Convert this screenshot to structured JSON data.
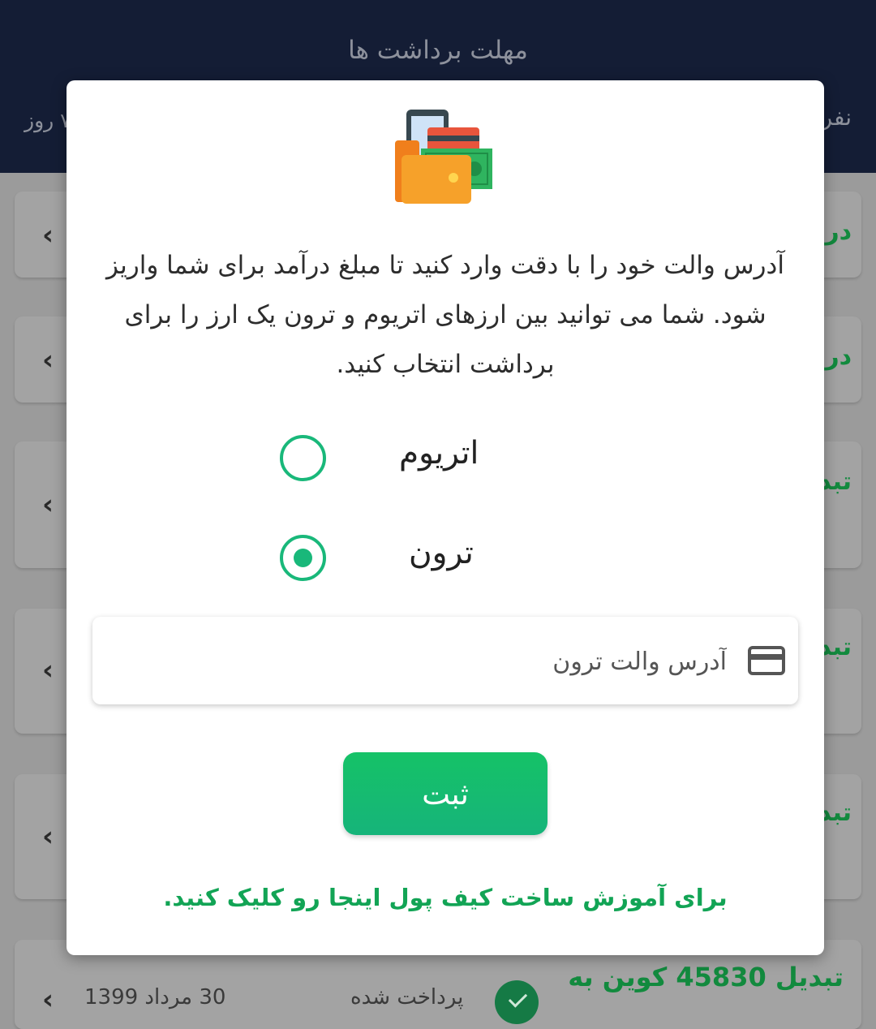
{
  "header": {
    "title": "مهلت برداشت ها",
    "left_text": "۷ روز",
    "right_text": "نفر"
  },
  "background_cards": [
    {
      "text": "در"
    },
    {
      "text": "در"
    },
    {
      "text": "تبد"
    },
    {
      "text": "تبد"
    },
    {
      "text": "تبد"
    }
  ],
  "last_card": {
    "title": "تبدیل 45830 کوین به",
    "status": "پرداخت شده",
    "date": "30 مرداد 1399"
  },
  "modal": {
    "icon": "wallet-icon",
    "description": "آدرس والت خود را با دقت وارد کنید تا مبلغ درآمد برای شما واریز شود. شما می توانید بین ارزهای اتریوم و ترون یک ارز را برای برداشت انتخاب کنید.",
    "options": [
      {
        "label": "اتریوم",
        "selected": false
      },
      {
        "label": "ترون",
        "selected": true
      }
    ],
    "input": {
      "value": "",
      "placeholder": "آدرس والت ترون",
      "icon": "credit-card-icon"
    },
    "submit_label": "ثبت",
    "tutorial_link": "برای آموزش ساخت کیف پول اینجا رو کلیک کنید.",
    "colors": {
      "accent": "#19b87a",
      "button": "#15c267",
      "link": "#12a455"
    }
  }
}
